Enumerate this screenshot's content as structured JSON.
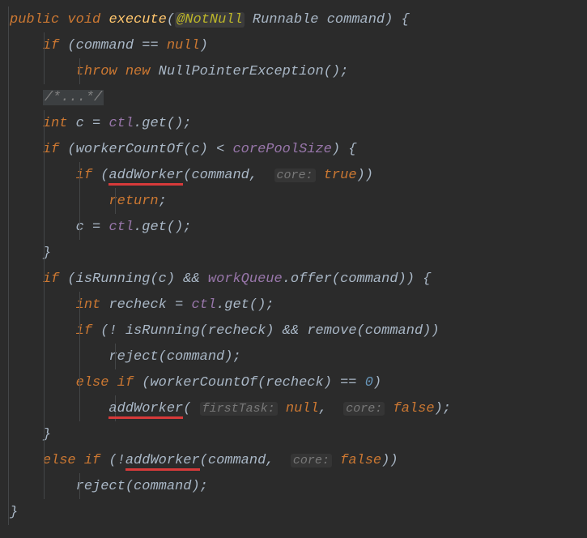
{
  "tokens": {
    "public": "public",
    "void": "void",
    "execute": "execute",
    "notnull": "@NotNull",
    "runnable": "Runnable",
    "command": "command",
    "if": "if",
    "null": "null",
    "throw": "throw",
    "new": "new",
    "npe": "NullPointerException",
    "comment": "/*...*/",
    "int": "int",
    "c": "c",
    "ctl": "ctl",
    "get": "get",
    "workerCountOf": "workerCountOf",
    "corePoolSize": "corePoolSize",
    "addWorker": "addWorker",
    "corehint": "core:",
    "true": "true",
    "false": "false",
    "return": "return",
    "isRunning": "isRunning",
    "workQueue": "workQueue",
    "offer": "offer",
    "recheck": "recheck",
    "remove": "remove",
    "reject": "reject",
    "else": "else",
    "firstTaskHint": "firstTask:",
    "eq": "==",
    "zero": "0",
    "lt": "<",
    "amp": "&&",
    "bang": "!",
    "eqassign": "="
  }
}
